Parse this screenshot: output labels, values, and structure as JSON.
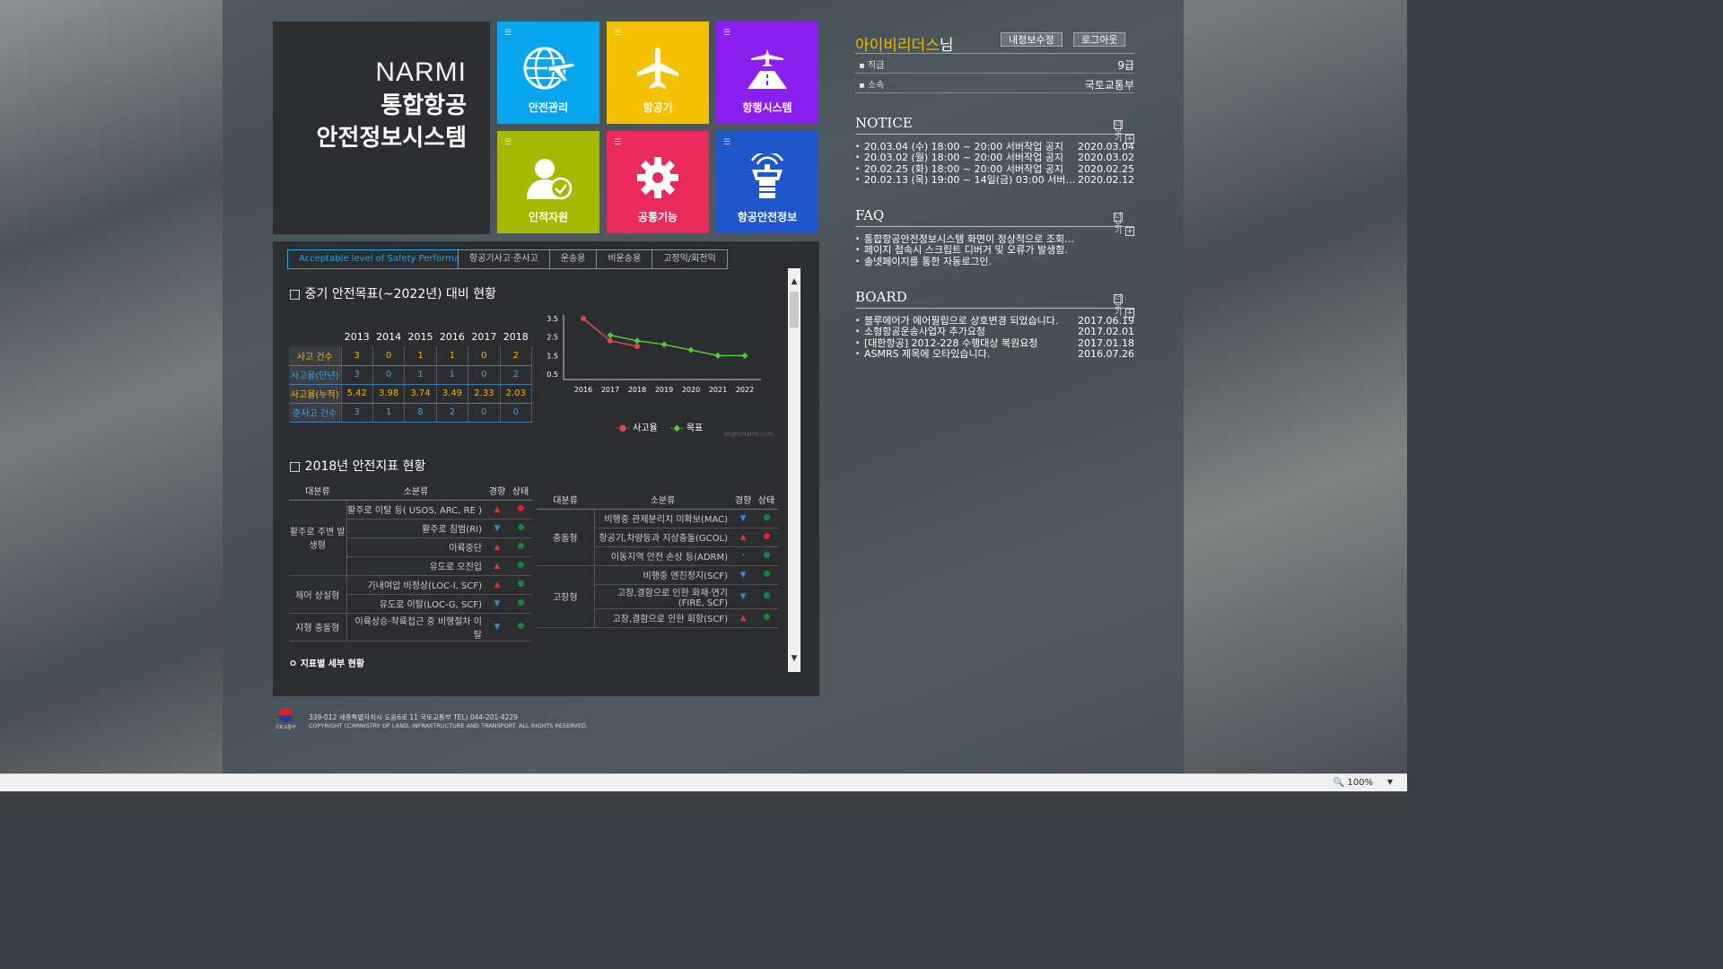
{
  "brand": {
    "title_en": "NARMI",
    "title_ko_1": "통합항공",
    "title_ko_2": "안전정보시스템"
  },
  "tiles": [
    {
      "label": "안전관리",
      "color": "#07a6ee",
      "icon": "globe-plane-icon"
    },
    {
      "label": "항공기",
      "color": "#f5c200",
      "icon": "airplane-icon"
    },
    {
      "label": "항행시스템",
      "color": "#8a1ff0",
      "icon": "runway-plane-icon"
    },
    {
      "label": "인적자원",
      "color": "#a6b800",
      "icon": "person-check-icon"
    },
    {
      "label": "공통기능",
      "color": "#ea2a5a",
      "icon": "gear-icon"
    },
    {
      "label": "항공안전정보",
      "color": "#1f56cc",
      "icon": "control-tower-icon"
    }
  ],
  "tabs": [
    "Acceptable level of Safety Performance",
    "항공기사고·준사고",
    "운송용",
    "비운송용",
    "고정익/회전익"
  ],
  "section1_title": "□ 중기 안전목표(~2022년) 대비 현황",
  "perf_table": {
    "years": [
      "2013",
      "2014",
      "2015",
      "2016",
      "2017",
      "2018"
    ],
    "rows": [
      {
        "label": "사고 건수",
        "values": [
          "3",
          "0",
          "1",
          "1",
          "0",
          "2"
        ]
      },
      {
        "label": "사고율(단년)",
        "values": [
          "3",
          "0",
          "1",
          "1",
          "0",
          "2"
        ]
      },
      {
        "label": "사고율(누적)",
        "values": [
          "5.42",
          "3.98",
          "3.74",
          "3.49",
          "2.33",
          "2.03"
        ]
      },
      {
        "label": "준사고 건수",
        "values": [
          "3",
          "1",
          "8",
          "2",
          "0",
          "0"
        ]
      }
    ]
  },
  "chart_data": {
    "type": "line",
    "x": [
      "2016",
      "2017",
      "2018",
      "2019",
      "2020",
      "2021",
      "2022"
    ],
    "yticks": [
      "0.5",
      "1.5",
      "2.5",
      "3.5"
    ],
    "ylim": [
      0.5,
      3.5
    ],
    "series": [
      {
        "name": "사고율",
        "color": "#e8434d",
        "values": [
          3.5,
          2.3,
          2.0,
          null,
          null,
          null,
          null
        ]
      },
      {
        "name": "목표",
        "color": "#4bd12a",
        "values": [
          null,
          2.6,
          2.3,
          2.1,
          1.8,
          1.5,
          1.5
        ]
      }
    ],
    "credit": "Highcharts.com"
  },
  "section2_title": "□ 2018년 안전지표 현황",
  "ind_headers": [
    "대분류",
    "소분류",
    "경향",
    "상태"
  ],
  "ind_left": [
    {
      "cat": "활주로 주변 발생형",
      "span": 4,
      "items": [
        {
          "sub": "활주로 이탈 등( USOS, ARC, RE )",
          "trend": "up",
          "status": "red"
        },
        {
          "sub": "활주로 침범(RI)",
          "trend": "down",
          "status": "green"
        },
        {
          "sub": "이륙중단",
          "trend": "up",
          "status": "green"
        },
        {
          "sub": "유도로 오진입",
          "trend": "up",
          "status": "green"
        }
      ]
    },
    {
      "cat": "제어 상실형",
      "span": 2,
      "items": [
        {
          "sub": "기내여압 비정상(LOC-I, SCF)",
          "trend": "up",
          "status": "green"
        },
        {
          "sub": "유도로 이탈(LOC-G, SCF)",
          "trend": "down",
          "status": "green"
        }
      ]
    },
    {
      "cat": "지형 충돌형",
      "span": 1,
      "items": [
        {
          "sub": "이륙상승·착륙접근 중 비행절차 이탈",
          "trend": "down",
          "status": "green"
        }
      ]
    }
  ],
  "ind_right": [
    {
      "cat": "충돌형",
      "span": 3,
      "items": [
        {
          "sub": "비행중 관제분리치 미확보(MAC)",
          "trend": "down",
          "status": "green"
        },
        {
          "sub": "항공기,차량등과 지상충돌(GCOL)",
          "trend": "up",
          "status": "red"
        },
        {
          "sub": "이동지역 안전 손상 등(ADRM)",
          "trend": "none",
          "status": "green"
        }
      ]
    },
    {
      "cat": "고장형",
      "span": 3,
      "items": [
        {
          "sub": "비행중 엔진정지(SCF)",
          "trend": "down",
          "status": "green"
        },
        {
          "sub": "고장,결함으로 인한 화재·연기(FIRE, SCF)",
          "trend": "down",
          "status": "green"
        },
        {
          "sub": "고장,결함으로 인한 회항(SCF)",
          "trend": "up",
          "status": "green"
        }
      ]
    }
  ],
  "detail_link": "지표별 세부 현황",
  "footer": {
    "address": "339-012 세종특별자치시 도움6로 11 국토교통부    TEL) 044-201-4229",
    "copyright": "COPYRIGHT (C)MINISTRY OF LAND, INFRASTRUCTURE AND TRANSPORT. ALL RIGHTS RESERVED.",
    "emblem_caption": "국토교통부"
  },
  "user": {
    "name": "아이비리더스",
    "suffix": "님",
    "edit_button": "내정보수정",
    "logout_button": "로그아웃",
    "rank_label": "직급",
    "rank_value": "9급",
    "dept_label": "소속",
    "dept_value": "국토교통부"
  },
  "notice": {
    "title": "NOTICE",
    "more": "더보기",
    "items": [
      {
        "text": "20.03.04 (수) 18:00 ~ 20:00 서버작업 공지",
        "date": "2020.03.04"
      },
      {
        "text": "20.03.02 (월) 18:00 ~ 20:00 서버작업 공지",
        "date": "2020.03.02"
      },
      {
        "text": "20.02.25 (화) 18:00 ~ 20:00 서버작업 공지",
        "date": "2020.02.25"
      },
      {
        "text": "20.02.13 (목) 19:00 ~ 14일(금) 03:00 서버작···",
        "date": "2020.02.12"
      }
    ]
  },
  "faq": {
    "title": "FAQ",
    "more": "더보기",
    "items": [
      {
        "text": "통합항공안전정보시스템 화면이 정상적으로 조회되지 않음."
      },
      {
        "text": "페이지 접속시 스크립트 디버거 및 오류가 발생함."
      },
      {
        "text": "솔넷페이지를 통한 자동로그인."
      }
    ]
  },
  "board": {
    "title": "BOARD",
    "more": "더보기",
    "items": [
      {
        "text": "블루에어가 에어필립으로 상호변경 되었습니다.",
        "date": "2017.06.19"
      },
      {
        "text": "소형항공운송사업자 추가요청",
        "date": "2017.02.01"
      },
      {
        "text": "[대한항공] 2012-228 수행대상 복원요청",
        "date": "2017.01.18"
      },
      {
        "text": "ASMRS 제목에 오타있습니다.",
        "date": "2016.07.26"
      }
    ]
  },
  "statusbar": {
    "zoom": "100%"
  }
}
